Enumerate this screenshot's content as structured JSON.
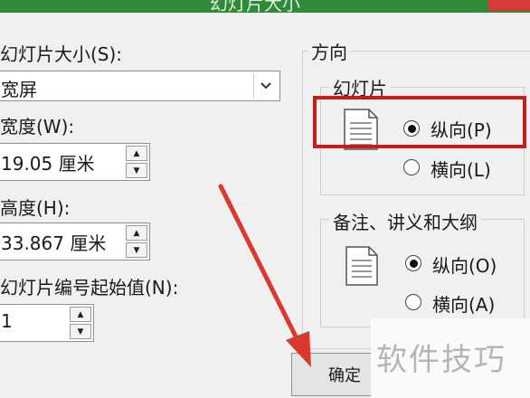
{
  "dialog": {
    "title": "幻灯片大小"
  },
  "slide_size": {
    "label": "幻灯片大小(S):",
    "value": "宽屏"
  },
  "width": {
    "label": "宽度(W):",
    "value": "19.05 厘米"
  },
  "height": {
    "label": "高度(H):",
    "value": "33.867 厘米"
  },
  "start_number": {
    "label": "幻灯片编号起始值(N):",
    "value": "1"
  },
  "orientation": {
    "title": "方向",
    "slides": {
      "title": "幻灯片",
      "portrait": "纵向(P)",
      "landscape": "横向(L)",
      "selected": "portrait"
    },
    "notes": {
      "title": "备注、讲义和大纲",
      "portrait": "纵向(O)",
      "landscape": "横向(A)",
      "selected": "portrait"
    }
  },
  "buttons": {
    "ok": "确定"
  },
  "watermark": "软件技巧",
  "colors": {
    "highlight": "#c21e1e",
    "arrow": "#d83a2e",
    "titlebar": "#2f8b3a"
  }
}
